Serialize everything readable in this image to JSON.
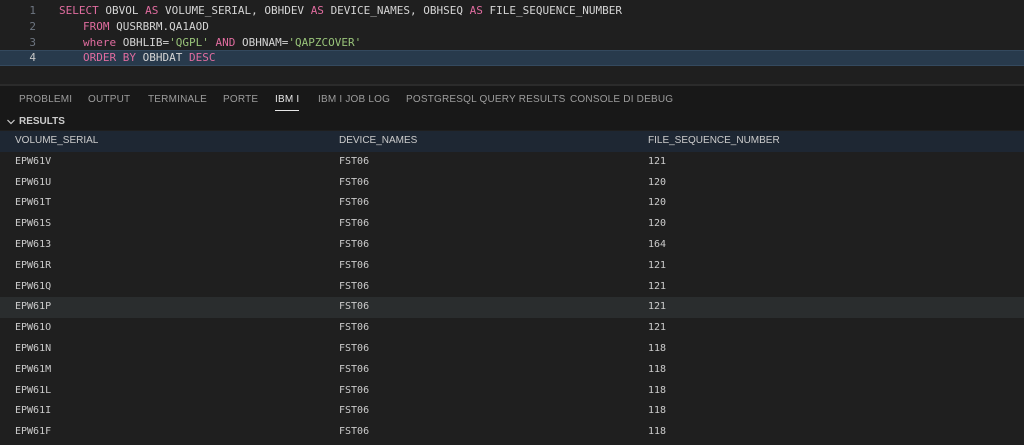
{
  "editor": {
    "lines": [
      {
        "number": "1",
        "parts": [
          {
            "t": "kw",
            "v": "SELECT "
          },
          {
            "t": "id",
            "v": "OBVOL "
          },
          {
            "t": "kw",
            "v": "AS "
          },
          {
            "t": "id",
            "v": "VOLUME_SERIAL, OBHDEV "
          },
          {
            "t": "kw",
            "v": "AS "
          },
          {
            "t": "id",
            "v": "DEVICE_NAMES, OBHSEQ "
          },
          {
            "t": "kw",
            "v": "AS "
          },
          {
            "t": "id",
            "v": "FILE_SEQUENCE_NUMBER"
          }
        ]
      },
      {
        "number": "2",
        "parts": [
          {
            "t": "kw",
            "v": "FROM "
          },
          {
            "t": "id",
            "v": "QUSRBRM.QA1AOD"
          }
        ]
      },
      {
        "number": "3",
        "parts": [
          {
            "t": "kw",
            "v": "where "
          },
          {
            "t": "id",
            "v": "OBHLIB="
          },
          {
            "t": "str",
            "v": "'QGPL'"
          },
          {
            "t": "kw",
            "v": " AND "
          },
          {
            "t": "id",
            "v": "OBHNAM="
          },
          {
            "t": "str",
            "v": "'QAPZCOVER'"
          }
        ]
      },
      {
        "number": "4",
        "parts": [
          {
            "t": "kw",
            "v": "ORDER BY "
          },
          {
            "t": "id",
            "v": "OBHDAT "
          },
          {
            "t": "kw",
            "v": "DESC"
          }
        ]
      }
    ]
  },
  "panel": {
    "tabs": [
      {
        "label": "PROBLEMI",
        "active": false
      },
      {
        "label": "OUTPUT",
        "active": false
      },
      {
        "label": "TERMINALE",
        "active": false
      },
      {
        "label": "PORTE",
        "active": false
      },
      {
        "label": "IBM I",
        "active": true
      },
      {
        "label": "IBM I JOB LOG",
        "active": false
      },
      {
        "label": "POSTGRESQL QUERY RESULTS",
        "active": false
      },
      {
        "label": "CONSOLE DI DEBUG",
        "active": false
      }
    ]
  },
  "results": {
    "section_title": "RESULTS",
    "columns": [
      "VOLUME_SERIAL",
      "DEVICE_NAMES",
      "FILE_SEQUENCE_NUMBER"
    ],
    "rows": [
      [
        "EPW61V",
        "FST06",
        "121"
      ],
      [
        "EPW61U",
        "FST06",
        "120"
      ],
      [
        "EPW61T",
        "FST06",
        "120"
      ],
      [
        "EPW61S",
        "FST06",
        "120"
      ],
      [
        "EPW613",
        "FST06",
        "164"
      ],
      [
        "EPW61R",
        "FST06",
        "121"
      ],
      [
        "EPW61Q",
        "FST06",
        "121"
      ],
      [
        "EPW61P",
        "FST06",
        "121"
      ],
      [
        "EPW61O",
        "FST06",
        "121"
      ],
      [
        "EPW61N",
        "FST06",
        "118"
      ],
      [
        "EPW61M",
        "FST06",
        "118"
      ],
      [
        "EPW61L",
        "FST06",
        "118"
      ],
      [
        "EPW61I",
        "FST06",
        "118"
      ],
      [
        "EPW61F",
        "FST06",
        "118"
      ]
    ],
    "selected_row": 7
  },
  "colors": {
    "background": "#1f1f1f",
    "keyword": "#e06c9f",
    "string": "#98c379",
    "current_line": "#283a4c",
    "header_row": "#1e2733"
  }
}
